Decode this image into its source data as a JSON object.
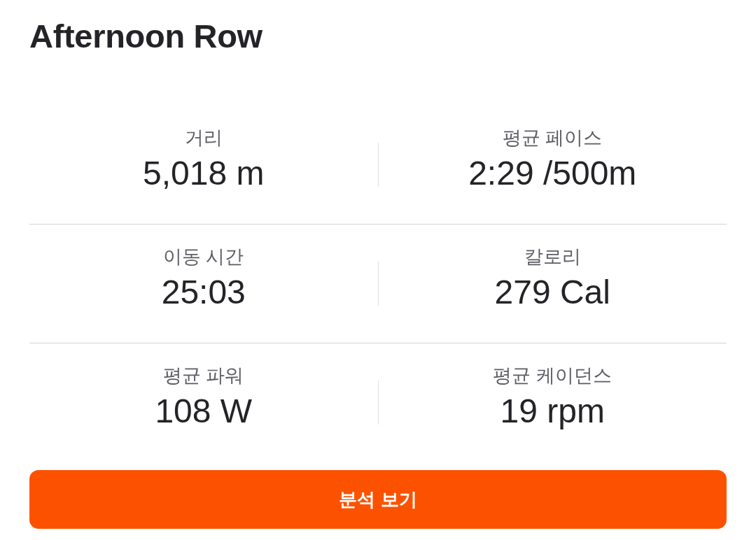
{
  "title": "Afternoon Row",
  "stats": [
    {
      "label": "거리",
      "value": "5,018 m"
    },
    {
      "label": "평균 페이스",
      "value": "2:29 /500m"
    },
    {
      "label": "이동 시간",
      "value": "25:03"
    },
    {
      "label": "칼로리",
      "value": "279 Cal"
    },
    {
      "label": "평균 파워",
      "value": "108 W"
    },
    {
      "label": "평균 케이던스",
      "value": "19 rpm"
    }
  ],
  "action_button": {
    "label": "분석 보기"
  }
}
